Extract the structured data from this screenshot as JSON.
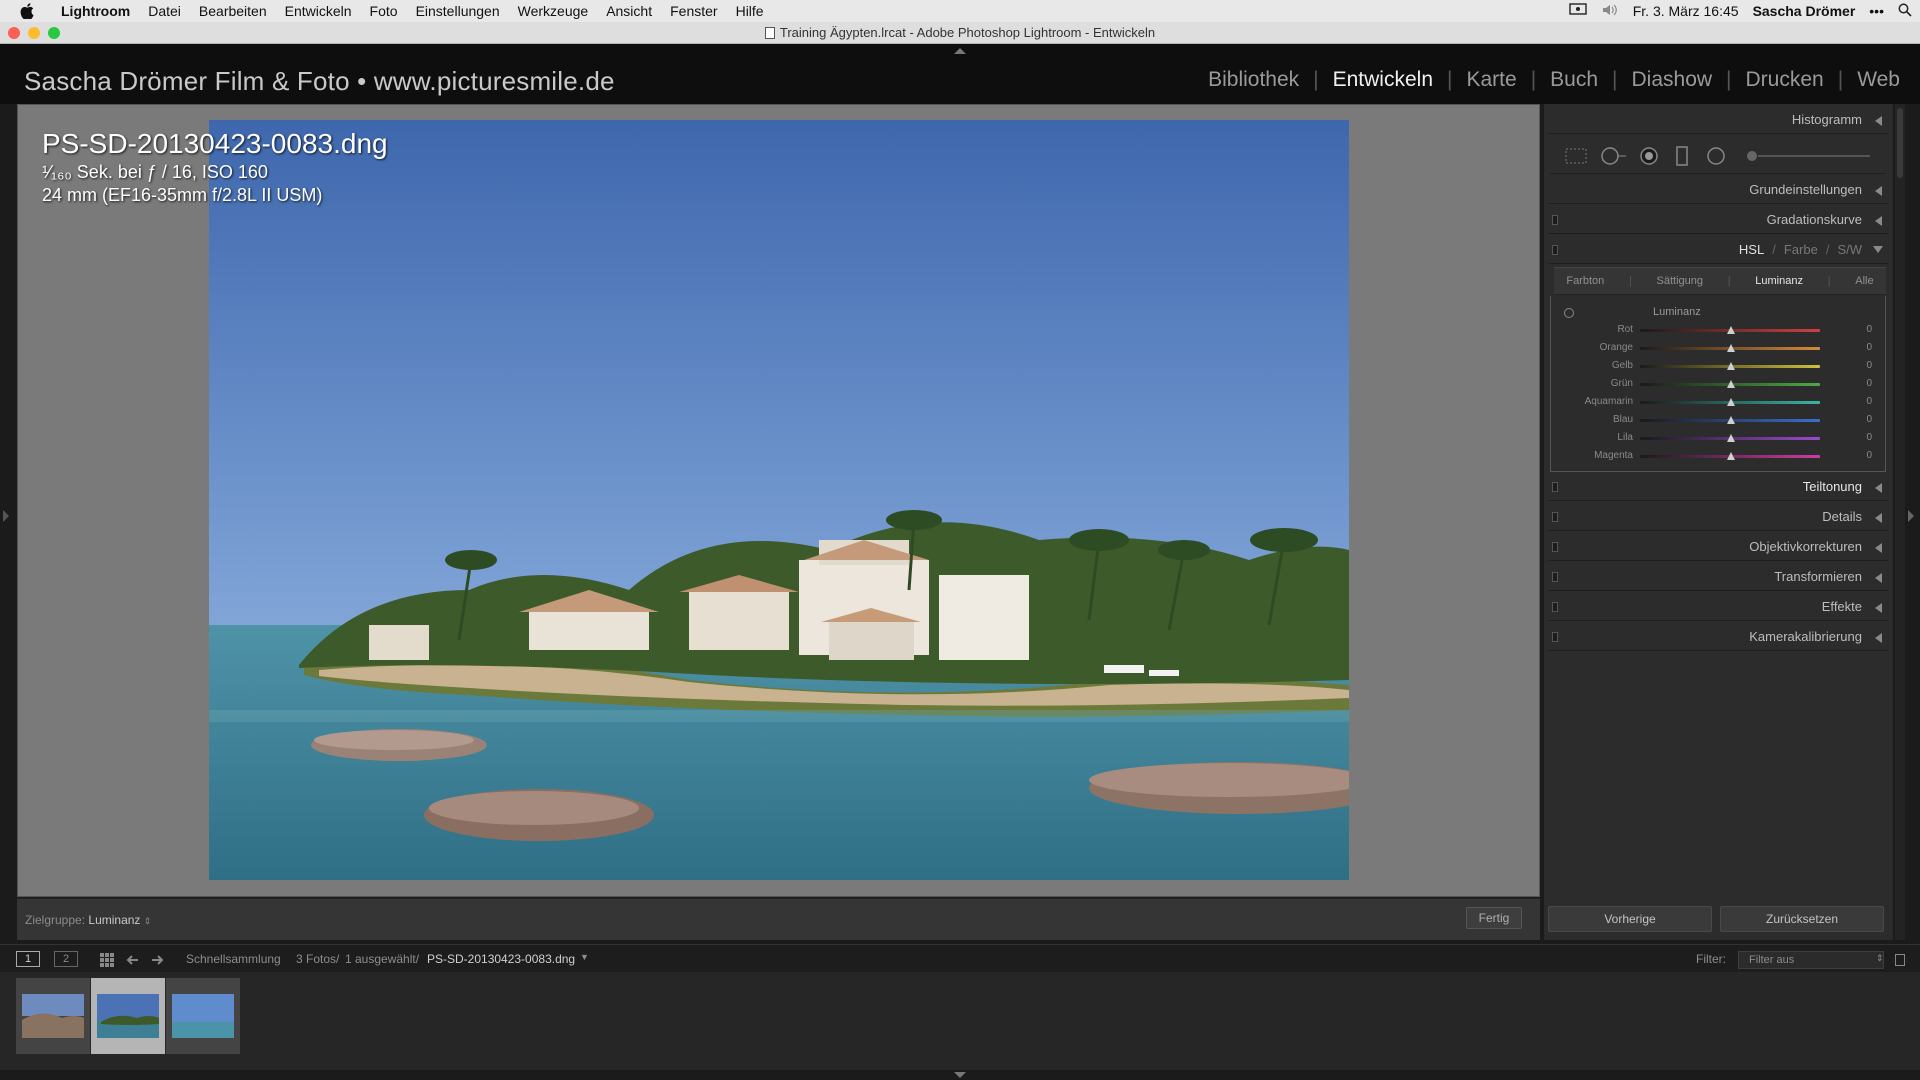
{
  "menubar": {
    "app": "Lightroom",
    "items": [
      "Datei",
      "Bearbeiten",
      "Entwickeln",
      "Foto",
      "Einstellungen",
      "Werkzeuge",
      "Ansicht",
      "Fenster",
      "Hilfe"
    ],
    "clock": "Fr. 3. März 16:45",
    "user": "Sascha Drömer",
    "more": "•••"
  },
  "window": {
    "title": "Training Ägypten.lrcat - Adobe Photoshop Lightroom - Entwickeln"
  },
  "header": {
    "identity_plate": "Sascha Drömer Film & Foto • www.picturesmile.de",
    "modules": [
      "Bibliothek",
      "Entwickeln",
      "Karte",
      "Buch",
      "Diashow",
      "Drucken",
      "Web"
    ],
    "active_module": "Entwickeln"
  },
  "photo_info": {
    "filename": "PS-SD-20130423-0083.dng",
    "exposure_line": "¹⁄₁₆₀ Sek. bei ƒ / 16, ISO 160",
    "lens_line": "24 mm (EF16-35mm f/2.8L II USM)"
  },
  "toolbar": {
    "target_label": "Zielgruppe:",
    "target_value": "Luminanz",
    "done_button": "Fertig"
  },
  "right_panel": {
    "histogram": "Histogramm",
    "basic": "Grundeinstellungen",
    "tone_curve": "Gradationskurve",
    "hsl_header": {
      "hsl": "HSL",
      "sep1": "/",
      "color": "Farbe",
      "sep2": "/",
      "bw": "S/W"
    },
    "hsl_tabs": [
      "Farbton",
      "Sättigung",
      "Luminanz",
      "Alle"
    ],
    "hsl_active_tab": "Luminanz",
    "hsl_section_title": "Luminanz",
    "hsl_sliders": [
      {
        "label": "Rot",
        "value": "0",
        "color": "#d04040"
      },
      {
        "label": "Orange",
        "value": "0",
        "color": "#d98a3a"
      },
      {
        "label": "Gelb",
        "value": "0",
        "color": "#cfc23a"
      },
      {
        "label": "Grün",
        "value": "0",
        "color": "#4caa44"
      },
      {
        "label": "Aquamarin",
        "value": "0",
        "color": "#3ab5a5"
      },
      {
        "label": "Blau",
        "value": "0",
        "color": "#3a6ed0"
      },
      {
        "label": "Lila",
        "value": "0",
        "color": "#9a4ad0"
      },
      {
        "label": "Magenta",
        "value": "0",
        "color": "#d03aa5"
      }
    ],
    "split_toning": "Teiltonung",
    "detail": "Details",
    "lens_corrections": "Objektivkorrekturen",
    "transform": "Transformieren",
    "effects": "Effekte",
    "camera_calibration": "Kamerakalibrierung",
    "previous_button": "Vorherige",
    "reset_button": "Zurücksetzen"
  },
  "filmstrip_bar": {
    "monitor1": "1",
    "monitor2": "2",
    "source": "Schnellsammlung",
    "count": "3 Fotos/",
    "selected": "1 ausgewählt/",
    "current_file": "PS-SD-20130423-0083.dng",
    "filter_label": "Filter:",
    "filter_value": "Filter aus"
  },
  "filmstrip": {
    "thumbnails": 3,
    "selected_index": 1
  }
}
